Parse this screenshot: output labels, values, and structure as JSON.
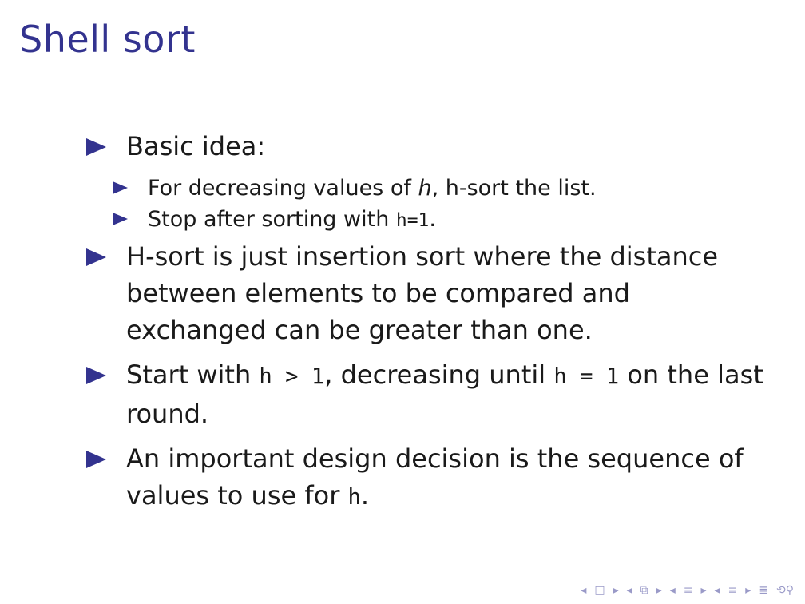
{
  "slide": {
    "title": "Shell sort"
  },
  "bullets": {
    "b1": "Basic idea:",
    "b1_sub1_pre": "For decreasing values of ",
    "b1_sub1_var": "h",
    "b1_sub1_post": ", h-sort the list.",
    "b1_sub2_pre": "Stop after sorting with ",
    "b1_sub2_code": "h=1",
    "b1_sub2_post": ".",
    "b2": "H-sort is just insertion sort where the distance between elements to be compared and exchanged can be greater than one.",
    "b3_pre": "Start with ",
    "b3_code1": "h > 1",
    "b3_mid": ", decreasing until ",
    "b3_code2": "h = 1",
    "b3_post": " on the last round.",
    "b4_pre": "An important design decision is the sequence of values to use for ",
    "b4_code": "h",
    "b4_post": "."
  },
  "nav": {
    "frame_left": "◂",
    "frame_right": "▸",
    "subsection_left": "◂",
    "subsection_right": "▸",
    "section_left": "◂",
    "section_right": "▸",
    "doc_left": "◂",
    "doc_right": "▸",
    "align": "≣",
    "search": "⟲⚲"
  },
  "colors": {
    "title": "#33338f",
    "bullet": "#33338f",
    "nav": "#9a9ac8"
  }
}
